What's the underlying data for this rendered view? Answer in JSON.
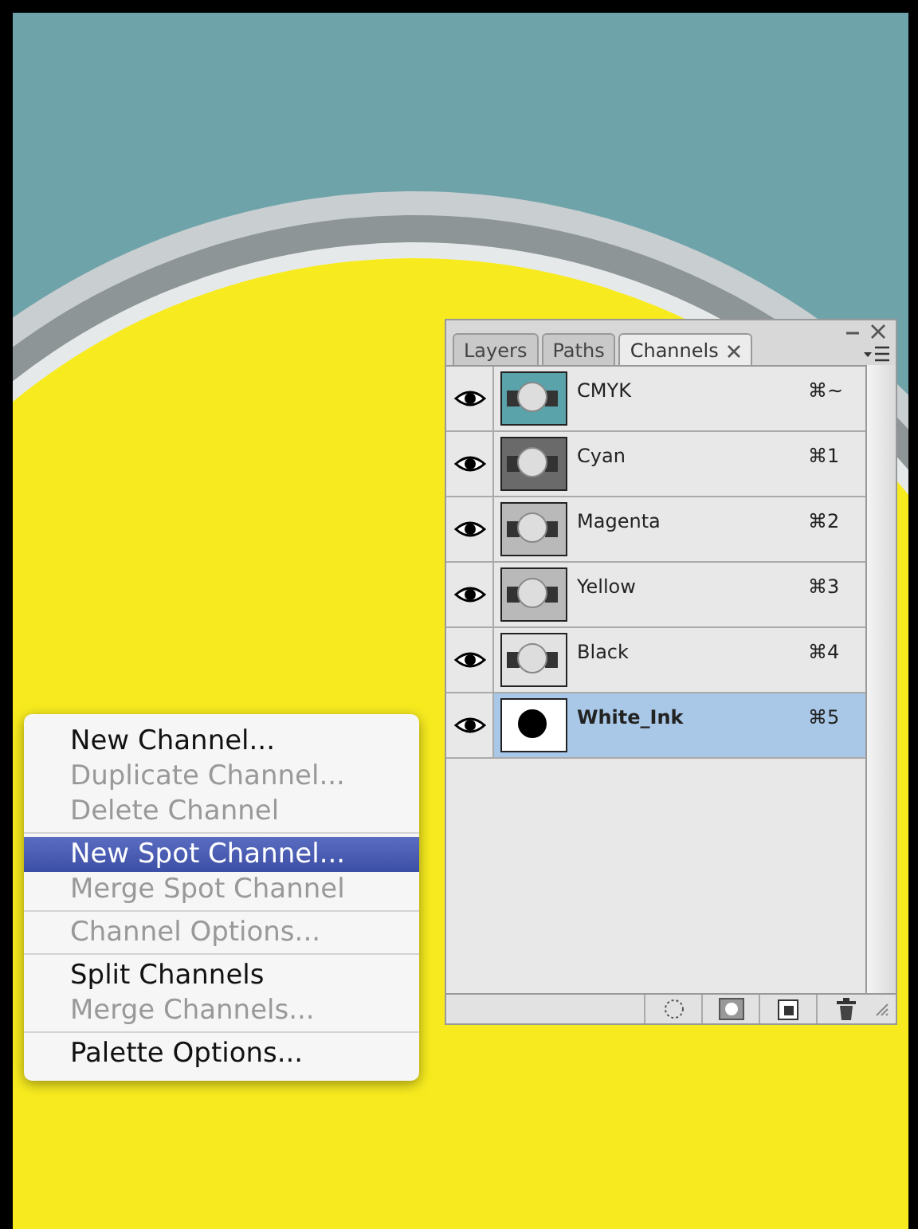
{
  "panel": {
    "tabs": [
      {
        "label": "Layers",
        "selected": false
      },
      {
        "label": "Paths",
        "selected": false
      },
      {
        "label": "Channels",
        "selected": true
      }
    ],
    "channels": [
      {
        "name": "CMYK",
        "shortcut": "⌘~",
        "visible": true,
        "selected": false,
        "kind": "color"
      },
      {
        "name": "Cyan",
        "shortcut": "⌘1",
        "visible": true,
        "selected": false,
        "kind": "dark"
      },
      {
        "name": "Magenta",
        "shortcut": "⌘2",
        "visible": true,
        "selected": false,
        "kind": "light"
      },
      {
        "name": "Yellow",
        "shortcut": "⌘3",
        "visible": true,
        "selected": false,
        "kind": "light"
      },
      {
        "name": "Black",
        "shortcut": "⌘4",
        "visible": true,
        "selected": false,
        "kind": "pale"
      },
      {
        "name": "White_Ink",
        "shortcut": "⌘5",
        "visible": true,
        "selected": true,
        "kind": "mask"
      }
    ]
  },
  "menu": {
    "groups": [
      [
        {
          "label": "New Channel...",
          "disabled": false,
          "selected": false
        },
        {
          "label": "Duplicate Channel...",
          "disabled": true,
          "selected": false
        },
        {
          "label": "Delete Channel",
          "disabled": true,
          "selected": false
        }
      ],
      [
        {
          "label": "New Spot Channel...",
          "disabled": false,
          "selected": true
        },
        {
          "label": "Merge Spot Channel",
          "disabled": true,
          "selected": false
        }
      ],
      [
        {
          "label": "Channel Options...",
          "disabled": true,
          "selected": false
        }
      ],
      [
        {
          "label": "Split Channels",
          "disabled": false,
          "selected": false
        },
        {
          "label": "Merge Channels...",
          "disabled": true,
          "selected": false
        }
      ],
      [
        {
          "label": "Palette Options...",
          "disabled": false,
          "selected": false
        }
      ]
    ]
  }
}
